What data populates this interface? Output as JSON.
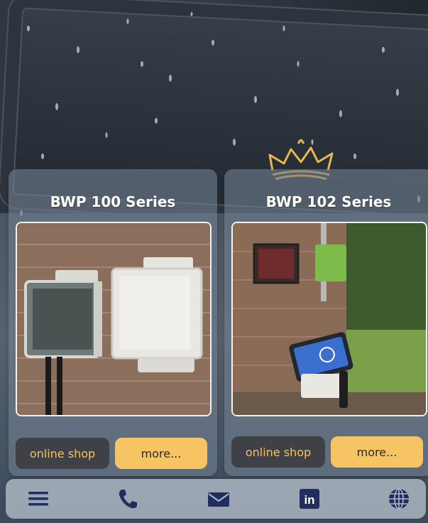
{
  "products": [
    {
      "title": "BWP 100 Series",
      "shop_label": "online shop",
      "more_label": "more..."
    },
    {
      "title": "BWP 102 Series",
      "shop_label": "online shop",
      "more_label": "more..."
    }
  ],
  "nav": {
    "items": [
      "menu-icon",
      "phone-icon",
      "mail-icon",
      "linkedin-icon",
      "globe-icon"
    ],
    "linkedin_glyph": "in"
  },
  "colors": {
    "accent": "#f7c463",
    "nav_icon": "#1f2e5e",
    "shop_text": "#f3c25e"
  }
}
